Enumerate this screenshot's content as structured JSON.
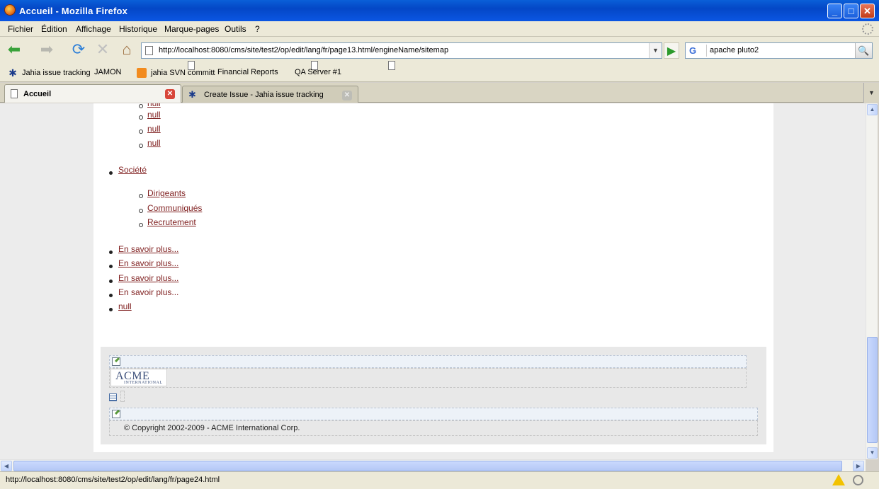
{
  "window": {
    "title": "Accueil - Mozilla Firefox",
    "min": "_",
    "max": "□",
    "close": "✕"
  },
  "menu": [
    "Fichier",
    "Édition",
    "Affichage",
    "Historique",
    "Marque-pages",
    "Outils",
    "?"
  ],
  "nav": {
    "back": "⬅",
    "forward": "➡",
    "reload": "⟳",
    "stop": "✕",
    "home": "⌂",
    "url": "http://localhost:8080/cms/site/test2/op/edit/lang/fr/page13.html/engineName/sitemap",
    "url_dropdown": "▼",
    "go": "▶"
  },
  "search": {
    "engine": "G",
    "query": "apache pluto2",
    "go": "🔍"
  },
  "bookmarks": [
    "Jahia issue tracking",
    "JAMON",
    "jahia SVN committ",
    "Financial Reports",
    "QA Server #1"
  ],
  "tabs": [
    {
      "label": "Accueil",
      "close": "✕"
    },
    {
      "label": "Create Issue - Jahia issue tracking",
      "close": "✕"
    }
  ],
  "tab_list": "▼",
  "content": {
    "nulls_top": [
      "null",
      "null",
      "null",
      "null"
    ],
    "societe": "Société",
    "societe_children": [
      "Dirigeants",
      "Communiqués",
      "Recrutement"
    ],
    "more_items": [
      "En savoir plus...",
      "En savoir plus...",
      "En savoir plus...",
      "En savoir plus..."
    ],
    "null_bottom": "null"
  },
  "footer": {
    "logo_big": "ACME",
    "logo_small": "INTERNATIONAL",
    "copyright": "© Copyright 2002-2009 - ACME International Corp."
  },
  "scroll": {
    "up": "▲",
    "down": "▼",
    "left": "◀",
    "right": "▶"
  },
  "status": {
    "text": "http://localhost:8080/cms/site/test2/op/edit/lang/fr/page24.html"
  }
}
